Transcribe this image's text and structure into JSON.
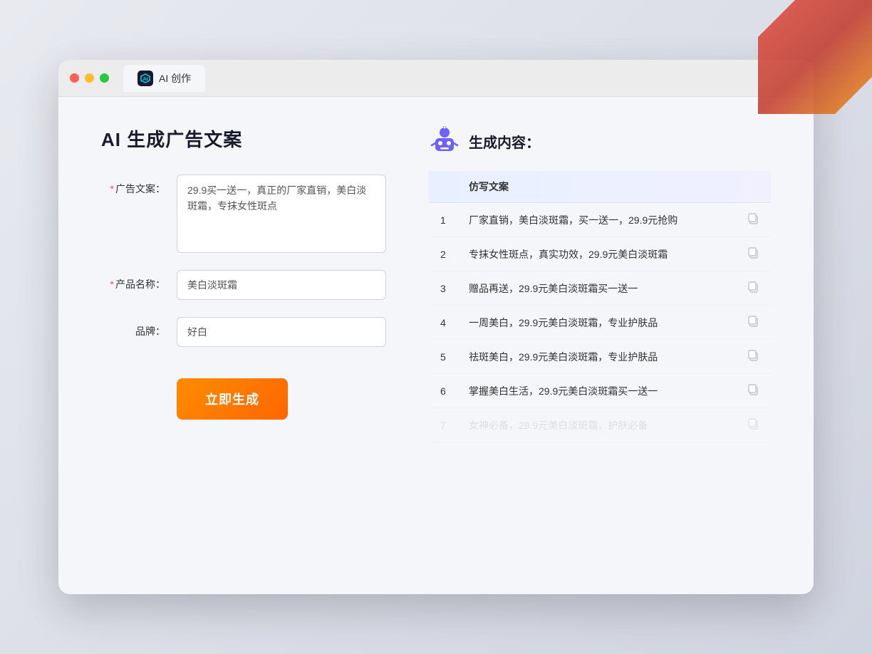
{
  "window": {
    "tab_label": "AI 创作",
    "tab_icon": "AI"
  },
  "traffic_lights": {
    "red": "#ff5f57",
    "yellow": "#febc2e",
    "green": "#28c840"
  },
  "left_panel": {
    "title": "AI 生成广告文案",
    "ad_copy_label": "广告文案：",
    "ad_copy_required": "*",
    "ad_copy_value": "29.9买一送一，真正的厂家直销，美白淡斑霜，专抹女性斑点",
    "product_name_label": "产品名称：",
    "product_name_required": "*",
    "product_name_value": "美白淡斑霜",
    "brand_label": "品牌：",
    "brand_value": "好白",
    "generate_button": "立即生成"
  },
  "right_panel": {
    "title": "生成内容：",
    "table_header": "仿写文案",
    "results": [
      {
        "num": "1",
        "text": "厂家直销，美白淡斑霜，买一送一，29.9元抢购"
      },
      {
        "num": "2",
        "text": "专抹女性斑点，真实功效，29.9元美白淡斑霜"
      },
      {
        "num": "3",
        "text": "赠品再送，29.9元美白淡斑霜买一送一"
      },
      {
        "num": "4",
        "text": "一周美白，29.9元美白淡斑霜，专业护肤品"
      },
      {
        "num": "5",
        "text": "祛斑美白，29.9元美白淡斑霜，专业护肤品"
      },
      {
        "num": "6",
        "text": "掌握美白生活，29.9元美白淡斑霜买一送一"
      },
      {
        "num": "7",
        "text": "女神必备，29.9元美白淡斑霜，护肤必备",
        "faded": true
      }
    ]
  }
}
